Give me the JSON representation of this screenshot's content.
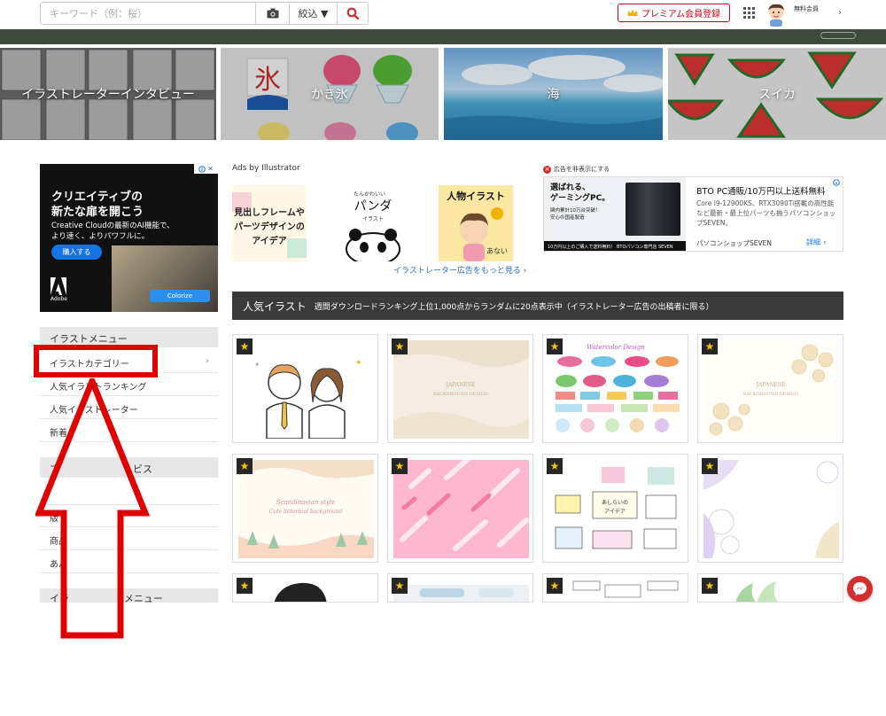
{
  "header": {
    "search_placeholder": "キーワード（例：桜）",
    "filter_label": "絞込 ▼",
    "premium_label": "プレミアム会員登録",
    "member_label": "無料会員",
    "chevron": "›"
  },
  "banners": [
    {
      "label": "イラストレーターインタビュー"
    },
    {
      "label": "かき氷"
    },
    {
      "label": "海"
    },
    {
      "label": "スイカ"
    }
  ],
  "left_ad": {
    "title_line1": "クリエイティブの",
    "title_line2": "新たな扉を開こう",
    "body_line1": "Creative Cloudの最新のAI機能で、",
    "body_line2": "より速く、よりパワフルに。",
    "cta": "購入する",
    "colorize": "Colorize",
    "brand": "Adobe"
  },
  "menu": {
    "illust_menu_header": "イラストメニュー",
    "items": [
      {
        "label": "イラストカテゴリー",
        "arrow": "›"
      },
      {
        "label": "人気イラストランキング"
      },
      {
        "label": "人気イラストレーター"
      },
      {
        "label": "新着イ"
      }
    ],
    "section2_header_start": "プ",
    "section2_header_end": "ビス",
    "section2_items": [
      {
        "label": "版"
      },
      {
        "label": "商品"
      },
      {
        "label": "あん"
      }
    ],
    "section3_header_start": "イラ",
    "section3_header_end": "メニュー"
  },
  "ads_by_illustrator": {
    "heading": "Ads by Illustrator",
    "thumb1_line1": "見出しフレームや",
    "thumb1_line2": "パーツデザインの",
    "thumb1_line3": "アイデア",
    "thumb2_small": "たんかわいい",
    "thumb2_title": "パンダ",
    "thumb2_sub": "イラスト",
    "thumb3_title": "人物イラスト",
    "thumb3_badge": "あない",
    "more_link": "イラストレーター広告をもっと見る ›"
  },
  "right_ad": {
    "hide_label": "広告を非表示にする",
    "headline1": "選ばれる、",
    "headline2": "ゲーミングPC。",
    "sub1": "関内累計10万台突破！",
    "sub2": "安心の国産製造",
    "bar": "10万円以上のご購入で送料無料！ BTOパソコン専門店 SEVEN",
    "title": "BTO PC通販/10万円以上送料無料",
    "desc": "Core i9-12900KS、RTX3090Ti搭載の高性能など最新・最上位パーツも揃うパソコンショップSEVEN。",
    "shop": "パソコンショップSEVEN",
    "detail": "詳細"
  },
  "popular": {
    "title": "人気イラスト",
    "subtitle": "週間ダウンロードランキング上位1,000点からランダムに20点表示中（イラストレーター広告の出稿者に限る）"
  },
  "cards": [
    {
      "star": "★",
      "text": ""
    },
    {
      "star": "★",
      "text": "JAPANESE BACKGROUND DESIGN"
    },
    {
      "star": "★",
      "text": "Watercolor Design"
    },
    {
      "star": "★",
      "text": "JAPANESE BACKGROUND DESIGN"
    },
    {
      "star": "★",
      "text": "Scandinavian style Cute botanical background"
    },
    {
      "star": "★",
      "text": ""
    },
    {
      "star": "★",
      "text": "あしらいの アイデア"
    },
    {
      "star": "★",
      "text": ""
    },
    {
      "star": "★",
      "text": ""
    },
    {
      "star": "★",
      "text": ""
    },
    {
      "star": "★",
      "text": ""
    },
    {
      "star": "★",
      "text": ""
    }
  ],
  "colors": {
    "accent_red": "#d32f2f",
    "dark_bar": "#3a3a3a",
    "link_blue": "#2a6cc3",
    "arrow_red": "#e00000",
    "band": "#3d4a3c"
  },
  "icons": [
    "camera-icon",
    "search-icon",
    "crown-icon",
    "apps-grid-icon",
    "avatar",
    "star-icon",
    "messenger-icon",
    "adobe-logo",
    "adchoices-icon"
  ]
}
